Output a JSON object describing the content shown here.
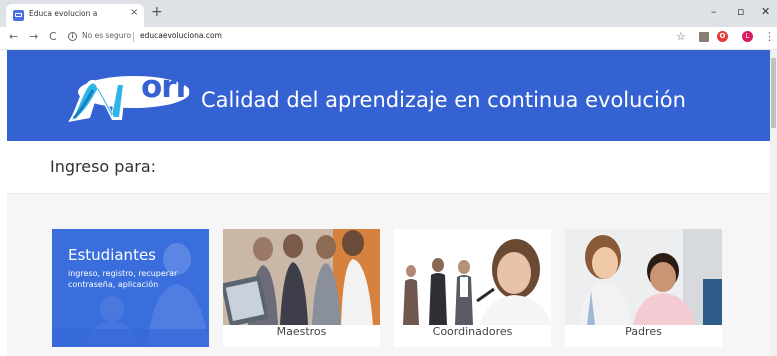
{
  "browser": {
    "tab_title": "Educa evolucion a",
    "tab_close": "×",
    "new_tab": "+",
    "security_label": "No es seguro",
    "url": "educaevoluciona.com",
    "avatar_initial": "L",
    "extension_badge": "O",
    "back_icon": "←",
    "forward_icon": "→",
    "reload_icon": "C",
    "star_icon": "☆",
    "menu_icon": "⋮",
    "minimize": "–",
    "maximize": "▫",
    "close": "✕"
  },
  "header": {
    "logo_text": "orma",
    "tagline": "Calidad del aprendizaje en continua evolución",
    "brand_color": "#3562d3"
  },
  "ingreso": {
    "label": "Ingreso para:"
  },
  "cards": {
    "estudiantes": {
      "title": "Estudiantes",
      "subtitle": "ingreso, registro, recuperar contraseña, aplicación"
    },
    "maestros": {
      "label": "Maestros"
    },
    "coordinadores": {
      "label": "Coordinadores"
    },
    "padres": {
      "label": "Padres"
    }
  }
}
